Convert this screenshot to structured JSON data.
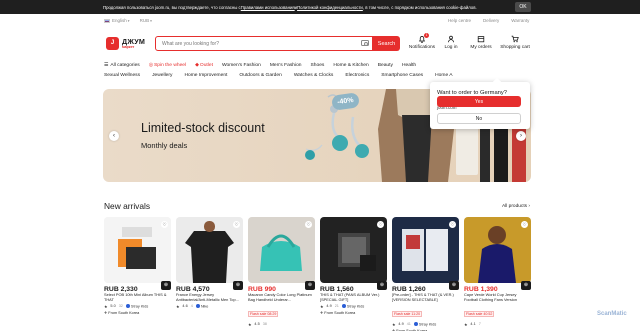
{
  "cookie": {
    "text_before": "Продолжая пользоваться joom.ru, вы подтверждаете, что согласны с ",
    "link1": "Правилами использования",
    "text_mid": " и ",
    "link2": "Политикой конфиденциальности",
    "text_after": ", в том числе, с порядком использования cookie-файлов.",
    "ok": "OK"
  },
  "topstrip": {
    "language": "English",
    "currency": "RUB",
    "help": "Help centre",
    "delivery": "Delivery",
    "warranty": "Warranty"
  },
  "header": {
    "logo_letter": "J",
    "brand": "ДЖУМ",
    "brand_sub": "маркет",
    "search_placeholder": "What are you looking for?",
    "search_button": "Search",
    "notifications": "Notifications",
    "notifications_count": "1",
    "login": "Log in",
    "orders": "My orders",
    "cart": "Shopping cart"
  },
  "categories": [
    "All categories",
    "Spin the wheel",
    "Outlet",
    "Women's Fashion",
    "Men's Fashion",
    "Shoes",
    "Home & Kitchen",
    "Beauty",
    "Health"
  ],
  "subcategories": [
    "Sexual Wellness",
    "Jewellery",
    "Home Improvement",
    "Outdoors & Garden",
    "Watches & Clocks",
    "Electronics",
    "Smartphone Cases",
    "Home A"
  ],
  "banner": {
    "title": "Limited-stock discount",
    "subtitle": "Monthly deals",
    "badge": "-40%"
  },
  "popup": {
    "title": "Want to order to Germany?",
    "text": "If yes, then you will be redirected to joom.com",
    "yes": "Yes",
    "no": "No"
  },
  "section": {
    "title": "New arrivals",
    "all": "All products"
  },
  "products": [
    {
      "price": "RUB 2,330",
      "name": "Select POB 10th Mini Album THIS & THAT",
      "flash": "",
      "rating": "5.0",
      "count": "32",
      "shop": "Stray Kids",
      "from": "From South Korea",
      "sale": false
    },
    {
      "price": "RUB 4,570",
      "name": "France Energy Jersey Antibacterial/Anti-Metallic Men Top...",
      "flash": "",
      "rating": "4.6",
      "count": "4",
      "shop": "Nike",
      "from": "",
      "sale": false
    },
    {
      "price": "RUB 990",
      "name": "Macaron Candy Color Long Platinum Bag Handheld Underar...",
      "flash": "Flash sale 08:29",
      "rating": "4.5",
      "count": "38",
      "shop": "",
      "from": "",
      "sale": true
    },
    {
      "price": "RUB 1,560",
      "name": "THIS & THAT (PANS ALBUM Ver.) [SPECIAL GIFT]",
      "flash": "",
      "rating": "4.9",
      "count": "21",
      "shop": "Stray Kids",
      "from": "From South Korea",
      "sale": false
    },
    {
      "price": "RUB 1,260",
      "name": "[Pre-order] - THIS & THAT (& VER.) [VERSION SELECTABLE]",
      "flash": "Flash sale 11:20",
      "rating": "4.9",
      "count": "41",
      "shop": "Stray Kids",
      "from": "From South Korea",
      "sale": false
    },
    {
      "price": "RUB 1,390",
      "name": "Cape Verde World Cup Jersey Football Clothing Fans Version",
      "flash": "Flash sale 40:52",
      "rating": "4.1",
      "count": "7",
      "shop": "",
      "from": "",
      "sale": true
    }
  ],
  "watermark": "ScanMatic"
}
